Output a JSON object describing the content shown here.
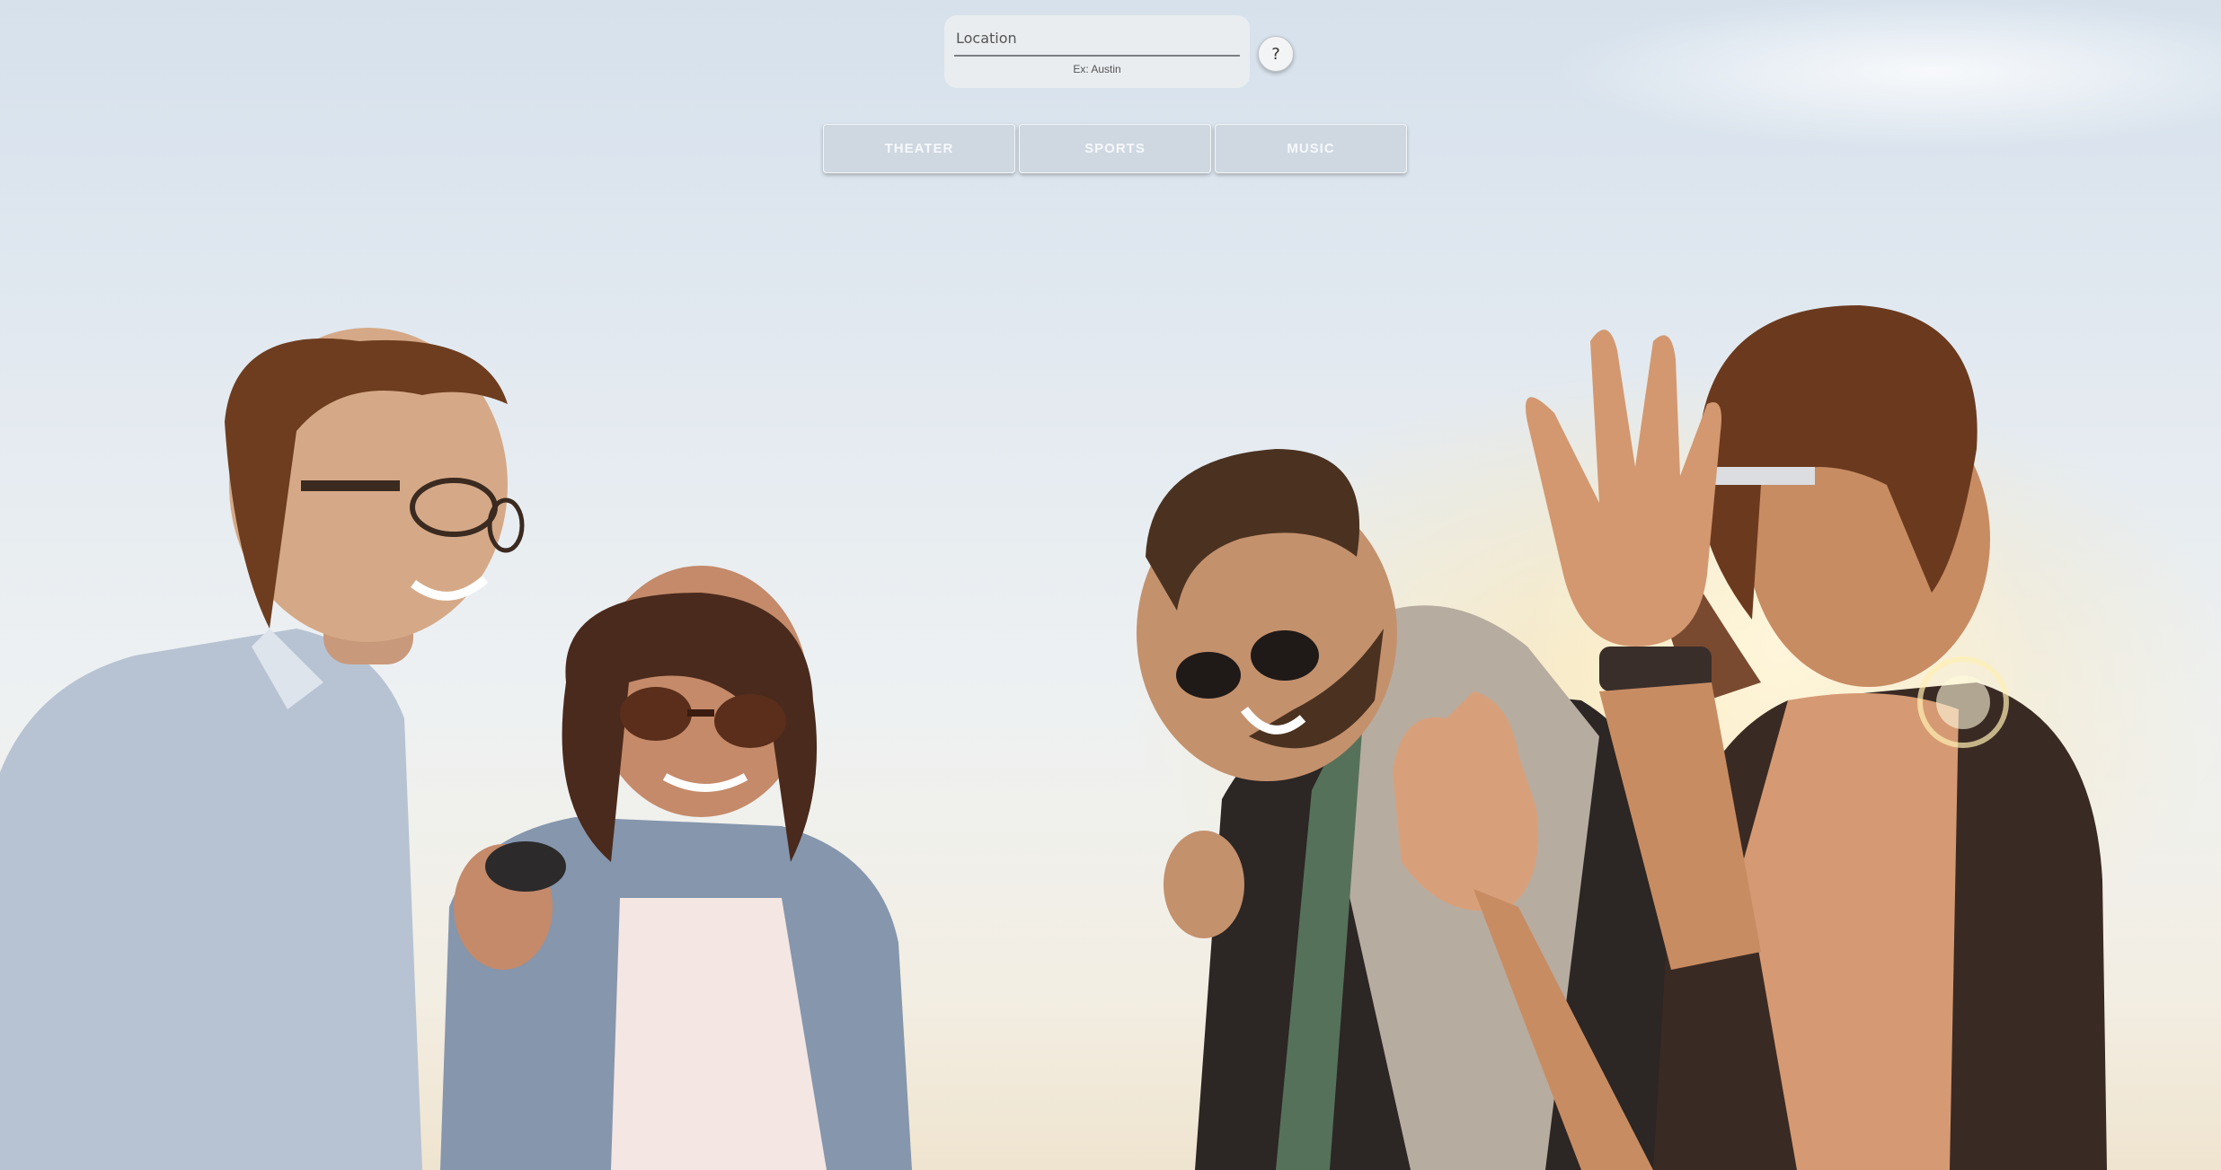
{
  "search": {
    "placeholder": "Location",
    "hint": "Ex: Austin"
  },
  "help": {
    "label": "?"
  },
  "categories": [
    {
      "label": "THEATER"
    },
    {
      "label": "SPORTS"
    },
    {
      "label": "MUSIC"
    }
  ],
  "background": {
    "icon": "friends-laughing-photo"
  }
}
